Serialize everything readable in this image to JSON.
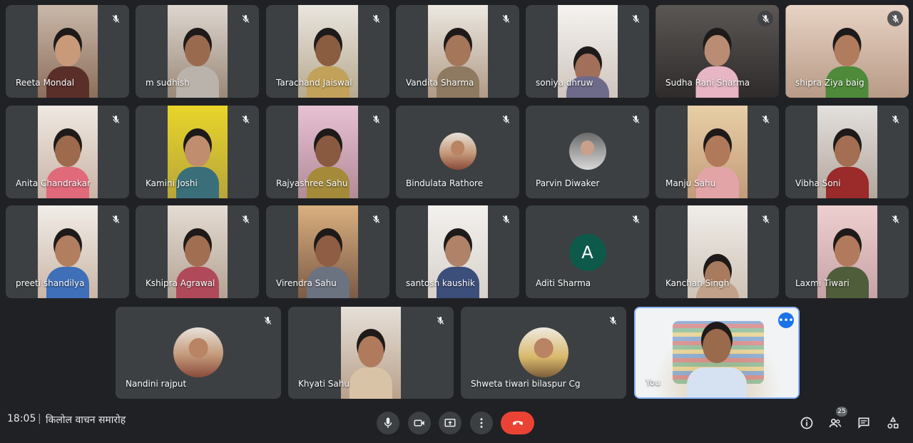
{
  "participants_row1": [
    {
      "name": "Reeta Mondal"
    },
    {
      "name": "m sudhish"
    },
    {
      "name": "Tarachand Jaiswal"
    },
    {
      "name": "Vandita Sharma"
    },
    {
      "name": "soniya dhruw"
    },
    {
      "name": "Sudha Rani Sharma"
    },
    {
      "name": "shipra Ziya baig"
    }
  ],
  "participants_row2": [
    {
      "name": "Anita Chandrakar"
    },
    {
      "name": "Kamini Joshi"
    },
    {
      "name": "Rajyashree Sahu"
    },
    {
      "name": "Bindulata Rathore"
    },
    {
      "name": "Parvin Diwaker"
    },
    {
      "name": "Manju Sahu"
    },
    {
      "name": "Vibha Soni"
    }
  ],
  "participants_row3": [
    {
      "name": "preeti shandilya"
    },
    {
      "name": "Kshipra Agrawal"
    },
    {
      "name": "Virendra Sahu"
    },
    {
      "name": "santosh kaushik"
    },
    {
      "name": "Aditi Sharma",
      "avatar_letter": "A"
    },
    {
      "name": "Kanchan Singh"
    },
    {
      "name": "Laxmi Tiwari"
    }
  ],
  "participants_row4": [
    {
      "name": "Nandini rajput"
    },
    {
      "name": "Khyati Sahu"
    },
    {
      "name": "Shweta tiwari bilaspur Cg"
    },
    {
      "name": "You"
    }
  ],
  "bottom_bar": {
    "time": "18:05",
    "divider": "|",
    "meeting_title": "किलोल वाचन समारोह",
    "participant_count": "25"
  },
  "colors": {
    "background": "#202124",
    "tile": "#3c4043",
    "hangup": "#ea4335",
    "self_border": "#8ab4f8"
  }
}
